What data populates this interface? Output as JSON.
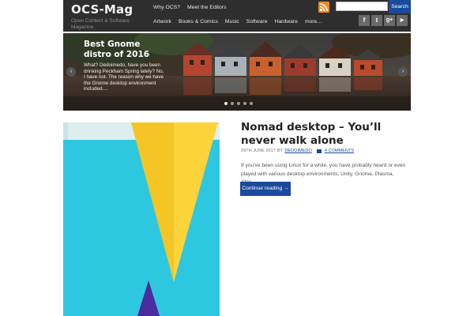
{
  "site": {
    "title": "OCS-Mag",
    "tagline": "Open Content & Software Magazine"
  },
  "nav": {
    "top": [
      "Why OCS?",
      "Meet the Editors"
    ],
    "main": [
      "Artwork",
      "Books & Comics",
      "Music",
      "Software",
      "Hardware",
      "more..."
    ]
  },
  "search": {
    "placeholder": "",
    "button_label": "Search"
  },
  "social": {
    "icons": [
      "facebook-icon",
      "twitter-icon",
      "google-plus-icon",
      "youtube-icon"
    ],
    "glyphs": [
      "f",
      "t",
      "g+",
      "▶"
    ]
  },
  "slider": {
    "title": "Best Gnome distro of 2016",
    "text": "What? Dedoimedo, have you been drinking Peckham Spring lately? No, I have not. The reason why we have the Gnome desktop environment included....",
    "prev": "‹",
    "next": "›",
    "dot_count": 5,
    "active_dot": 0
  },
  "post": {
    "title": "Nomad desktop – You’ll never walk alone",
    "date": "29TH JUNE 2017",
    "by": "BY",
    "author": "DEDOIMEDO",
    "comments": "4 COMMENTS",
    "excerpt": "If you’ve been using Linux for a while, you have probably heard or even played with various desktop environments; Unity, Gnome, Plasma, Xfce....",
    "continue_label": "Continue reading →"
  },
  "colors": {
    "header_bg": "#2e2e2e",
    "accent": "#1b4a9c",
    "rss": "#f2891f",
    "thumb_bg": "#2ec7e0",
    "thumb_yellow": "#fdd33a",
    "thumb_purple": "#4a2c9e"
  }
}
